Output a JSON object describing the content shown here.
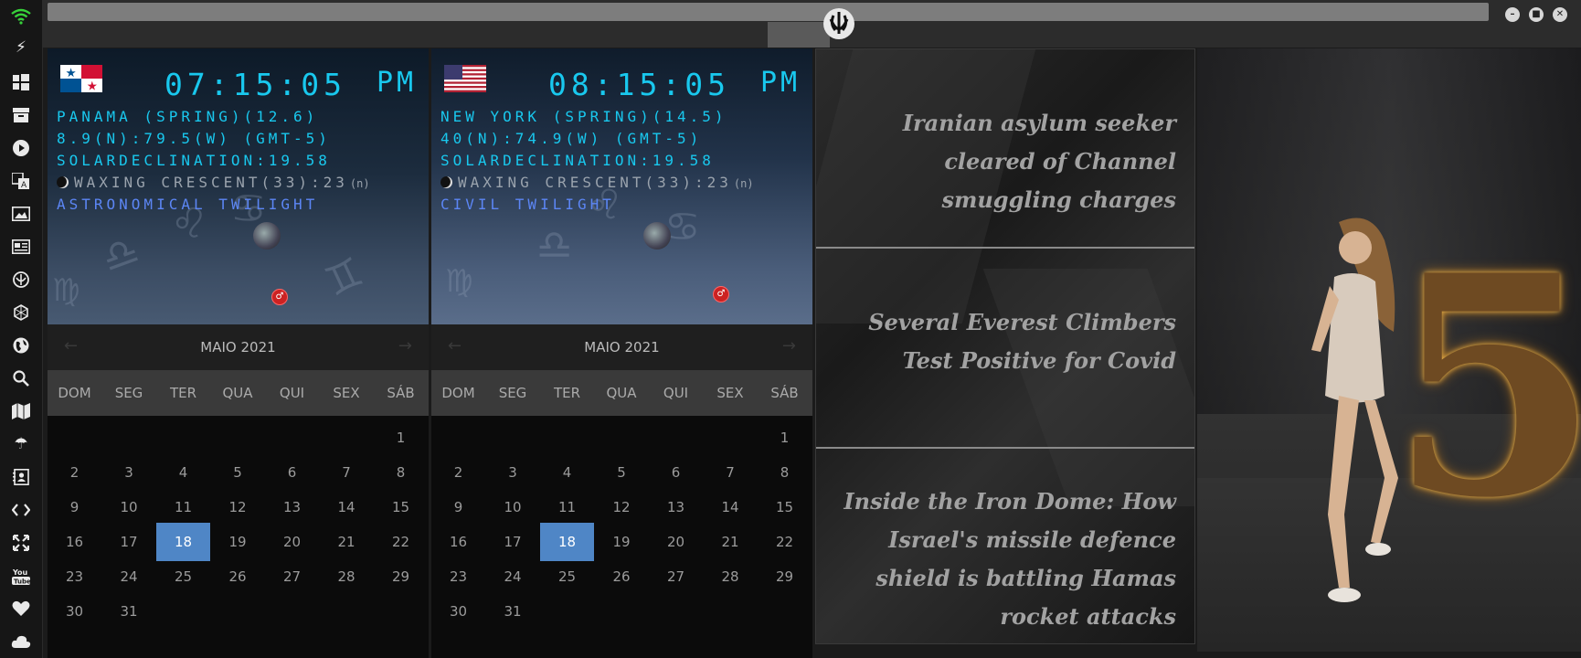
{
  "sidebar": {
    "icons": [
      "wifi-icon",
      "bolt-icon",
      "windows-icon",
      "archive-icon",
      "play-icon",
      "translate-icon",
      "image-icon",
      "news-icon",
      "rebel-icon",
      "hexagon-icon",
      "globe-icon",
      "search-icon",
      "map-icon",
      "umbrella-icon",
      "contact-icon",
      "code-icon",
      "expand-icon",
      "youtube-icon",
      "heart-icon",
      "cloud-icon"
    ]
  },
  "window": {
    "minimize": "–",
    "maximize": "■",
    "close": "✕"
  },
  "clocks": [
    {
      "flag": "panama",
      "time": "07:15:05",
      "ampm": "PM",
      "location": "PANAMA (SPRING)(12.6)",
      "coords": "8.9(N):79.5(W) (GMT-5)",
      "declination": "SOLARDECLINATION:19.58",
      "moon": "WAXING CRESCENT(33):23",
      "moon_suffix": "(n)",
      "twilight": "ASTRONOMICAL TWILIGHT"
    },
    {
      "flag": "usa",
      "time": "08:15:05",
      "ampm": "PM",
      "location": "NEW YORK (SPRING)(14.5)",
      "coords": "40(N):74.9(W) (GMT-5)",
      "declination": "SOLARDECLINATION:19.58",
      "moon": "WAXING CRESCENT(33):23",
      "moon_suffix": "(n)",
      "twilight": "CIVIL TWILIGHT"
    }
  ],
  "calendar": {
    "month": "MAIO 2021",
    "prev": "←",
    "next": "→",
    "weekdays": [
      "DOM",
      "SEG",
      "TER",
      "QUA",
      "QUI",
      "SEX",
      "SÁB"
    ],
    "first_weekday": 6,
    "days_in_month": 31,
    "today": 18
  },
  "news": [
    "Iranian asylum seeker cleared of Channel smuggling charges",
    "Several Everest Climbers Test Positive for Covid",
    "Inside the Iron Dome: How Israel's missile defence shield is battling Hamas rocket attacks"
  ],
  "colors": {
    "clock": "#19c8ee",
    "twilight": "#5c86f5",
    "today": "#4f86c6"
  }
}
